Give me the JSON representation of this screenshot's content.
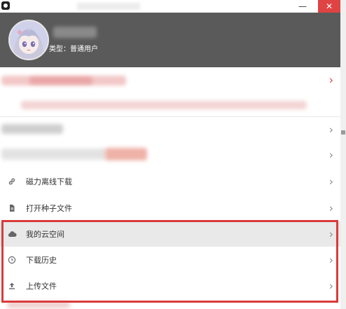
{
  "window": {
    "minimize_label": "—",
    "close_label": "✕"
  },
  "header": {
    "user_type": "类型：普通用户"
  },
  "menu": {
    "items": [
      {
        "label": "磁力离线下载",
        "icon": "link-icon"
      },
      {
        "label": "打开种子文件",
        "icon": "file-icon"
      },
      {
        "label": "我的云空间",
        "icon": "cloud-icon"
      },
      {
        "label": "下载历史",
        "icon": "clock-icon"
      },
      {
        "label": "上传文件",
        "icon": "upload-icon"
      }
    ],
    "chevron": "›"
  },
  "colors": {
    "header_bg": "#5a5a5a",
    "highlight_box": "#d93b3b",
    "close_btn": "#e04343"
  }
}
